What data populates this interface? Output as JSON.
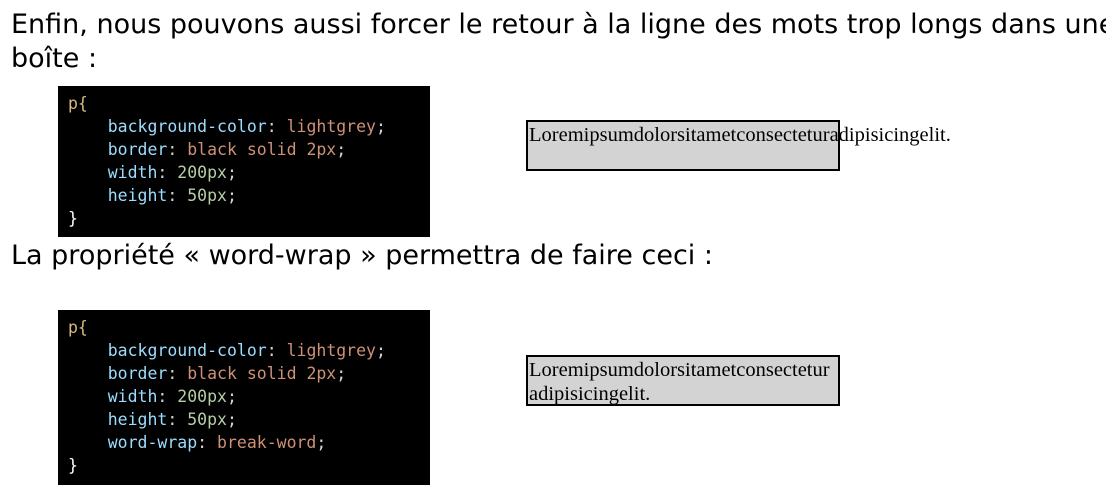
{
  "intro_text": "Enfin, nous pouvons aussi forcer le retour à la ligne des mots trop longs dans une",
  "intro_text_cont": "boîte :",
  "wordwrap_text": "La propriété « word-wrap » permettra de faire ceci :",
  "code1": {
    "selector": "p{",
    "lines": [
      {
        "prop": "background-color",
        "value": "lightgrey"
      },
      {
        "prop": "border",
        "value": "black solid 2px"
      },
      {
        "prop": "width",
        "value": "200px"
      },
      {
        "prop": "height",
        "value": "50px"
      }
    ],
    "close": "}"
  },
  "code2": {
    "selector": "p{",
    "lines": [
      {
        "prop": "background-color",
        "value": "lightgrey"
      },
      {
        "prop": "border",
        "value": "black solid 2px"
      },
      {
        "prop": "width",
        "value": "200px"
      },
      {
        "prop": "height",
        "value": "50px"
      },
      {
        "prop": "word-wrap",
        "value": "break-word"
      }
    ],
    "close": "}"
  },
  "demo_text": "Loremipsumdolorsitametconsecteturadipisicingelit.",
  "colors": {
    "code_bg": "#000000",
    "property": "#9cdcfe",
    "value": "#ce9178",
    "number": "#b5cea8",
    "selector": "#d7ba7d",
    "box_bg": "#d3d3d3"
  }
}
